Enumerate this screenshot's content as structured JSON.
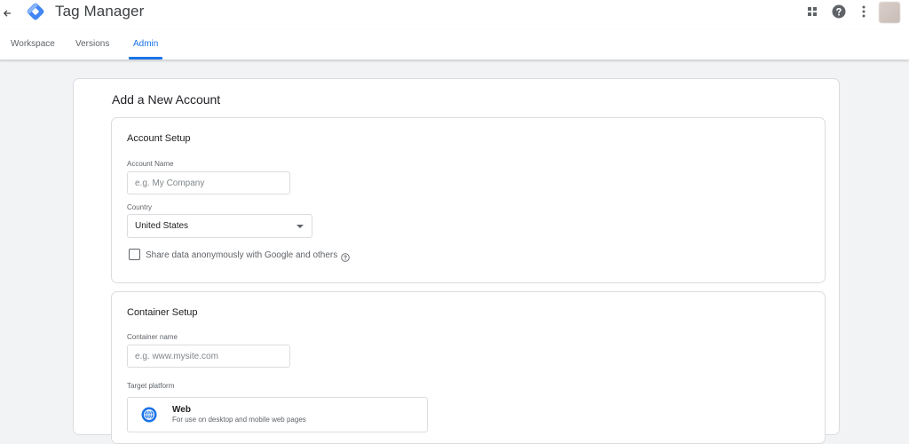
{
  "app": {
    "title": "Tag Manager"
  },
  "nav": {
    "tabs": [
      {
        "label": "Workspace"
      },
      {
        "label": "Versions"
      },
      {
        "label": "Admin"
      }
    ],
    "active_tab": "Admin"
  },
  "icons": {
    "back": "back-arrow-icon",
    "logo": "tag-manager-logo",
    "apps": "apps-grid-icon",
    "help": "help-icon",
    "more": "more-vert-icon"
  },
  "colors": {
    "accent": "#1a73e8",
    "logo_primary": "#4285f4",
    "logo_secondary": "#8ab4f8"
  },
  "form": {
    "title": "Add a New Account",
    "account_setup": {
      "title": "Account Setup",
      "account_name_label": "Account Name",
      "account_name_placeholder": "e.g. My Company",
      "account_name_value": "",
      "country_label": "Country",
      "country_value": "United States",
      "share_data_label": "Share data anonymously with Google and others",
      "share_data_checked": false
    },
    "container_setup": {
      "title": "Container Setup",
      "container_name_label": "Container name",
      "container_name_placeholder": "e.g. www.mysite.com",
      "container_name_value": "",
      "target_platform_label": "Target platform",
      "platforms": [
        {
          "name": "Web",
          "description": "For use on desktop and mobile web pages",
          "icon": "globe-icon"
        }
      ]
    }
  }
}
